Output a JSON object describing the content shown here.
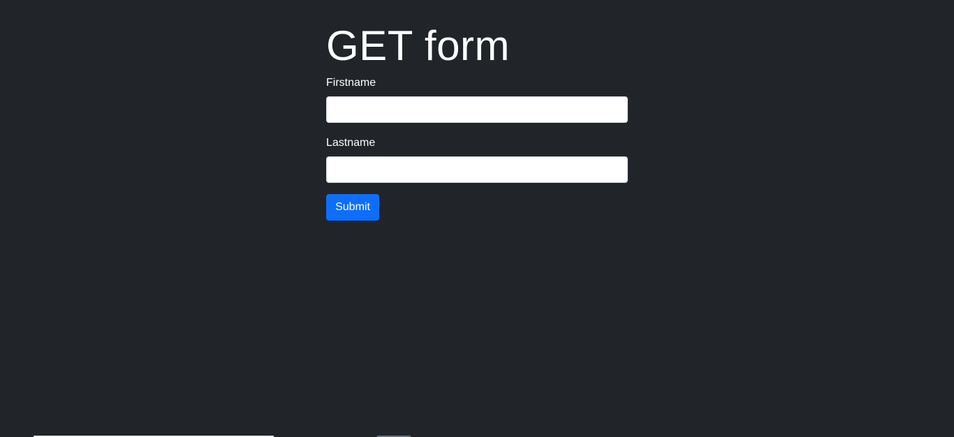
{
  "page": {
    "title": "GET form"
  },
  "form": {
    "firstname": {
      "label": "Firstname",
      "value": "",
      "placeholder": ""
    },
    "lastname": {
      "label": "Lastname",
      "value": "",
      "placeholder": ""
    },
    "submit_label": "Submit"
  },
  "colors": {
    "background": "#212529",
    "text": "#ffffff",
    "primary": "#0d6efd",
    "input_background": "#ffffff",
    "input_border": "#ced4da"
  }
}
